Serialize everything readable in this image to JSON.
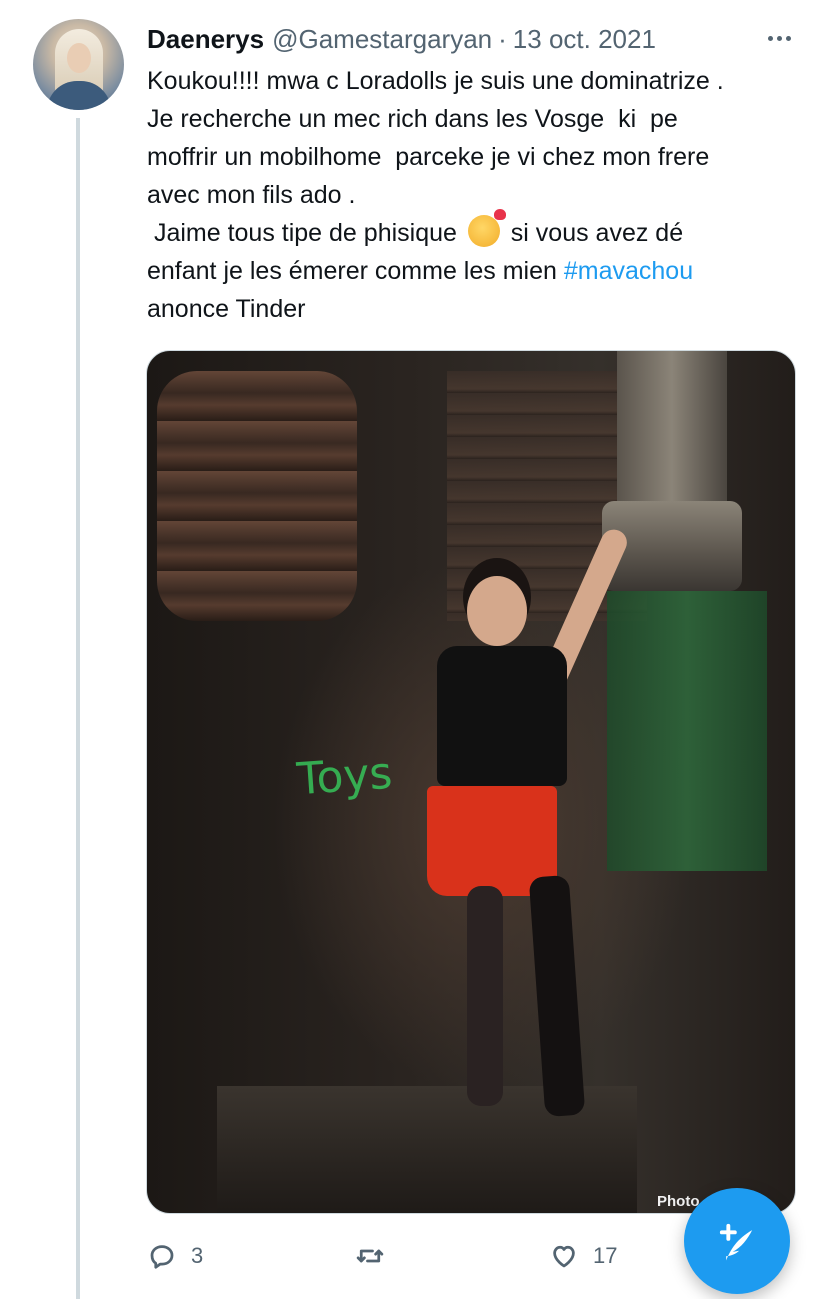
{
  "tweet": {
    "author": {
      "display_name": "Daenerys",
      "handle": "@Gamestargaryan"
    },
    "separator": "·",
    "date": "13 oct. 2021",
    "text_lines": [
      "Koukou!!!! mwa c Loradolls je suis une dominatrize .",
      "Je recherche un mec rich dans les Vosge  ki  pe",
      "moffrir un mobilhome  parceke je vi chez mon frere",
      "avec mon fils ado .",
      " Jaime tous tipe de phisique ",
      " si vous avez dé",
      "enfant je les émerer comme les mien ",
      "#mavachou",
      "anonce Tinder"
    ],
    "emoji": "smiling-face-with-hearts",
    "media": {
      "graffiti_text": "Toys",
      "watermark": "Photo"
    },
    "actions": {
      "reply_count": "3",
      "like_count": "17"
    }
  },
  "colors": {
    "accent": "#1d9bf0",
    "secondary_text": "#536471",
    "primary_text": "#0f1419",
    "thread_line": "#cfd9de"
  },
  "icons": [
    "more-icon",
    "reply-icon",
    "retweet-icon",
    "like-icon",
    "compose-icon"
  ]
}
